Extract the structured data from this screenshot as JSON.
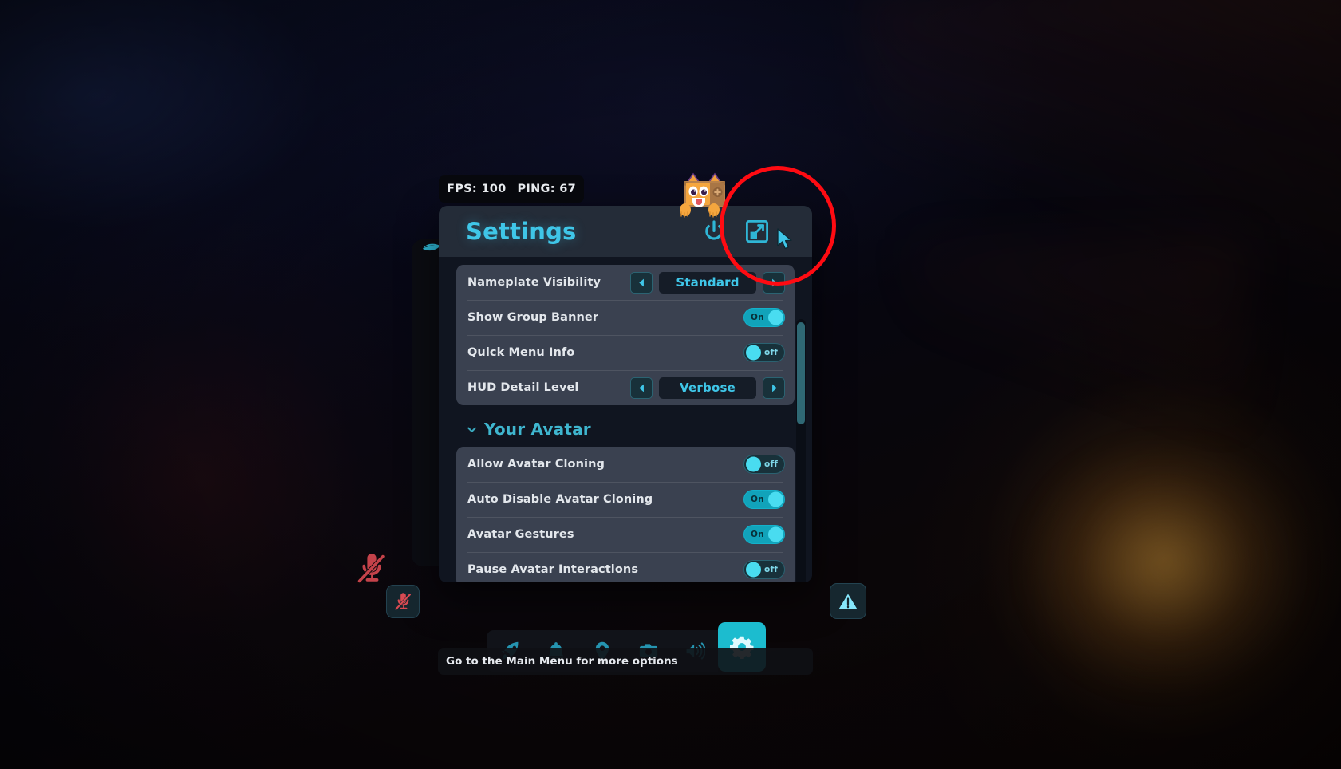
{
  "hud": {
    "fps_label": "FPS: 100",
    "ping_label": "PING: 67"
  },
  "panel": {
    "title": "Settings",
    "header_icons": [
      {
        "name": "power-icon",
        "label": "Power"
      },
      {
        "name": "expand-icon",
        "label": "Expand"
      }
    ],
    "groups": [
      {
        "rows": [
          {
            "label": "Nameplate Visibility",
            "control": "stepper",
            "value": "Standard",
            "prev": "◀",
            "next": "▶"
          },
          {
            "label": "Show Group Banner",
            "control": "toggle",
            "state": "on",
            "state_label": "On"
          },
          {
            "label": "Quick Menu Info",
            "control": "toggle",
            "state": "off",
            "state_label": "off"
          },
          {
            "label": "HUD Detail Level",
            "control": "stepper",
            "value": "Verbose",
            "prev": "◀",
            "next": "▶"
          }
        ]
      }
    ],
    "section": {
      "title": "Your Avatar",
      "expanded": true,
      "rows": [
        {
          "label": "Allow Avatar Cloning",
          "control": "toggle",
          "state": "off",
          "state_label": "off"
        },
        {
          "label": "Auto Disable Avatar Cloning",
          "control": "toggle",
          "state": "on",
          "state_label": "On"
        },
        {
          "label": "Avatar Gestures",
          "control": "toggle",
          "state": "on",
          "state_label": "On"
        },
        {
          "label": "Pause Avatar Interactions",
          "control": "toggle",
          "state": "off",
          "state_label": "off"
        }
      ]
    }
  },
  "taskbar": {
    "items": [
      {
        "name": "rocket-icon",
        "label": "Launch",
        "active": false
      },
      {
        "name": "bell-icon",
        "label": "Notifications",
        "active": false
      },
      {
        "name": "location-pin-icon",
        "label": "Location",
        "active": false
      },
      {
        "name": "camera-icon",
        "label": "Camera",
        "active": false
      },
      {
        "name": "speaker-icon",
        "label": "Audio",
        "active": false
      },
      {
        "name": "gear-icon",
        "label": "Settings",
        "active": true
      }
    ]
  },
  "status": {
    "hint": "Go to the Main Menu for more options",
    "mic_muted_label": "Microphone muted",
    "warning_label": "Warning"
  },
  "colors": {
    "accent": "#3fc6e8",
    "toggle_on": "#11a3ba",
    "knob": "#49dcf0",
    "panel_bg": "#171d28",
    "row_bg": "#3a4150",
    "annotation_red": "#ff0b12",
    "mute_red": "#d94a52"
  }
}
